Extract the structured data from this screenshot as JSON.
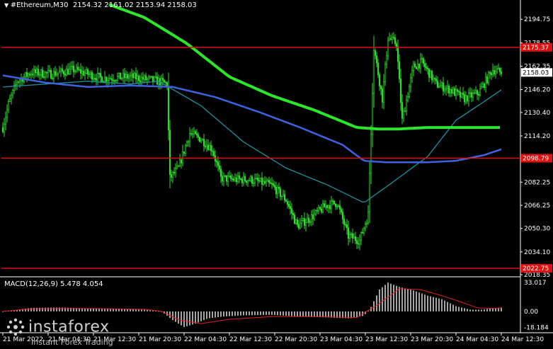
{
  "header": {
    "symbol": "#Ethereum,M30",
    "ohlc": "2154.32 2161.02 2153.94 2158.03"
  },
  "colors": {
    "background": "#000000",
    "candle": "#33d633",
    "ma_fast": "#1e8fa0",
    "ma_mid": "#3f63e0",
    "ma_slow": "#2ee52e",
    "level": "#e01010",
    "macd_hist": "#b8b8b8",
    "macd_signal": "#e02020"
  },
  "chart_data": [
    {
      "type": "candlestick",
      "title": "#Ethereum,M30",
      "ylim": [
        2018.35,
        2202.2
      ],
      "y_ticks": [
        "2194.75",
        "2178.55",
        "2162.35",
        "2146.20",
        "2130.40",
        "2114.20",
        "2098.80",
        "2082.25",
        "2066.25",
        "2050.30",
        "2034.10",
        "2018.35"
      ],
      "last_price": "2158.03",
      "x_ticks": [
        "21 Mar 2022",
        "21 Mar 04:30",
        "21 Mar 12:30",
        "21 Mar 20:30",
        "22 Mar 04:30",
        "22 Mar 12:30",
        "22 Mar 20:30",
        "23 Mar 04:30",
        "23 Mar 12:30",
        "23 Mar 20:30",
        "24 Mar 04:30",
        "24 Mar 12:30"
      ],
      "levels": [
        {
          "value": 2175.37,
          "label": "2175.37"
        },
        {
          "value": 2098.79,
          "label": "2098.79"
        },
        {
          "value": 2022.75,
          "label": "2022.75"
        }
      ],
      "series": [
        {
          "name": "price",
          "anchors": [
            [
              0,
              2120
            ],
            [
              4,
              2136
            ],
            [
              10,
              2152
            ],
            [
              20,
              2158
            ],
            [
              35,
              2157
            ],
            [
              50,
              2160
            ],
            [
              70,
              2154
            ],
            [
              90,
              2155
            ],
            [
              110,
              2152
            ],
            [
              116,
              2150
            ],
            [
              118,
              2085
            ],
            [
              124,
              2092
            ],
            [
              132,
              2116
            ],
            [
              140,
              2112
            ],
            [
              148,
              2105
            ],
            [
              154,
              2085
            ],
            [
              165,
              2084
            ],
            [
              175,
              2084
            ],
            [
              190,
              2080
            ],
            [
              200,
              2070
            ],
            [
              208,
              2052
            ],
            [
              218,
              2058
            ],
            [
              228,
              2066
            ],
            [
              236,
              2068
            ],
            [
              244,
              2045
            ],
            [
              252,
              2042
            ],
            [
              258,
              2060
            ],
            [
              262,
              2175
            ],
            [
              268,
              2140
            ],
            [
              272,
              2182
            ],
            [
              278,
              2178
            ],
            [
              282,
              2125
            ],
            [
              290,
              2162
            ],
            [
              296,
              2165
            ],
            [
              306,
              2150
            ],
            [
              316,
              2146
            ],
            [
              326,
              2140
            ],
            [
              336,
              2144
            ],
            [
              346,
              2160
            ],
            [
              352,
              2158
            ]
          ]
        },
        {
          "name": "MA fast",
          "points": [
            [
              0,
              2148
            ],
            [
              30,
              2150
            ],
            [
              60,
              2152
            ],
            [
              90,
              2150
            ],
            [
              110,
              2152
            ],
            [
              140,
              2135
            ],
            [
              170,
              2110
            ],
            [
              200,
              2092
            ],
            [
              230,
              2080
            ],
            [
              255,
              2068
            ],
            [
              275,
              2082
            ],
            [
              300,
              2100
            ],
            [
              320,
              2125
            ],
            [
              340,
              2138
            ],
            [
              352,
              2146
            ]
          ]
        },
        {
          "name": "MA mid",
          "points": [
            [
              0,
              2156
            ],
            [
              30,
              2151
            ],
            [
              60,
              2148
            ],
            [
              90,
              2149
            ],
            [
              120,
              2148
            ],
            [
              150,
              2141
            ],
            [
              180,
              2131
            ],
            [
              210,
              2120
            ],
            [
              240,
              2108
            ],
            [
              255,
              2097
            ],
            [
              270,
              2096
            ],
            [
              300,
              2096
            ],
            [
              320,
              2097
            ],
            [
              340,
              2101
            ],
            [
              352,
              2105
            ]
          ]
        },
        {
          "name": "MA slow",
          "points": [
            [
              75,
              2205
            ],
            [
              100,
              2196
            ],
            [
              130,
              2178
            ],
            [
              160,
              2155
            ],
            [
              190,
              2142
            ],
            [
              220,
              2132
            ],
            [
              250,
              2120
            ],
            [
              265,
              2119
            ],
            [
              280,
              2119
            ],
            [
              300,
              2120
            ],
            [
              320,
              2120
            ],
            [
              340,
              2120
            ],
            [
              352,
              2120
            ]
          ]
        }
      ]
    },
    {
      "type": "histogram",
      "title": "MACD(12,26,9) 5.478 4.054",
      "ylim": [
        -22,
        38
      ],
      "y_ticks": [
        "33.017",
        "0.00",
        "-18.184"
      ],
      "series": [
        {
          "name": "histogram",
          "points": [
            [
              0,
              0
            ],
            [
              10,
              2
            ],
            [
              20,
              4
            ],
            [
              40,
              4.5
            ],
            [
              60,
              3.5
            ],
            [
              80,
              2.8
            ],
            [
              100,
              2
            ],
            [
              112,
              0
            ],
            [
              120,
              -10
            ],
            [
              128,
              -18
            ],
            [
              136,
              -14
            ],
            [
              145,
              -8
            ],
            [
              155,
              -6
            ],
            [
              170,
              -4.5
            ],
            [
              190,
              -4
            ],
            [
              210,
              -6
            ],
            [
              230,
              -7
            ],
            [
              245,
              -8
            ],
            [
              255,
              -5
            ],
            [
              260,
              5
            ],
            [
              266,
              25
            ],
            [
              272,
              33
            ],
            [
              280,
              28
            ],
            [
              290,
              24
            ],
            [
              300,
              18
            ],
            [
              310,
              14
            ],
            [
              320,
              6
            ],
            [
              330,
              2
            ],
            [
              338,
              2
            ],
            [
              345,
              3.5
            ],
            [
              352,
              4.5
            ]
          ]
        },
        {
          "name": "signal",
          "points": [
            [
              0,
              0
            ],
            [
              20,
              3
            ],
            [
              60,
              3.4
            ],
            [
              100,
              2.5
            ],
            [
              112,
              0
            ],
            [
              125,
              -10
            ],
            [
              140,
              -14
            ],
            [
              160,
              -9
            ],
            [
              190,
              -6
            ],
            [
              220,
              -6
            ],
            [
              250,
              -7
            ],
            [
              265,
              8
            ],
            [
              280,
              26
            ],
            [
              295,
              25
            ],
            [
              310,
              18
            ],
            [
              325,
              10
            ],
            [
              335,
              4
            ],
            [
              345,
              3.5
            ],
            [
              352,
              4
            ]
          ]
        }
      ]
    }
  ],
  "watermark": {
    "brand": "instaforex",
    "subtitle": "Instant Forex Trading"
  }
}
